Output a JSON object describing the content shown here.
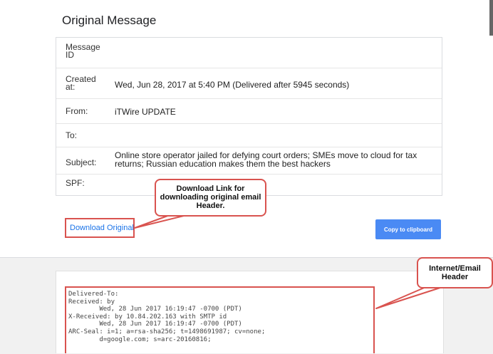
{
  "page": {
    "title": "Original Message",
    "fields": [
      {
        "label": "Message ID",
        "value": ""
      },
      {
        "label": "Created at:",
        "value": "Wed, Jun 28, 2017 at 5:40 PM (Delivered after 5945 seconds)"
      },
      {
        "label": "From:",
        "value": "iTWire UPDATE"
      },
      {
        "label": "To:",
        "value": ""
      },
      {
        "label": "Subject:",
        "value": "Online store operator jailed for defying court orders; SMEs move to cloud for tax returns; Russian education makes them the best hackers"
      },
      {
        "label": "SPF:",
        "value": ""
      }
    ],
    "download_link": "Download Original",
    "copy_button": "Copy to clipboard",
    "header_text": "Delivered-To:\nReceived: by\n        Wed, 28 Jun 2017 16:19:47 -0700 (PDT)\nX-Received: by 10.84.202.163 with SMTP id\n        Wed, 28 Jun 2017 16:19:47 -0700 (PDT)\nARC-Seal: i=1; a=rsa-sha256; t=1498691987; cv=none;\n        d=google.com; s=arc-20160816;"
  },
  "annotations": {
    "download_callout": "Download Link for downloading original email Header.",
    "header_callout": "Internet/Email Header"
  },
  "colors": {
    "annotation_red": "#d9534f",
    "link_blue": "#1a73e8",
    "button_blue": "#4a8af4",
    "gray_background": "#f1f1f1"
  }
}
